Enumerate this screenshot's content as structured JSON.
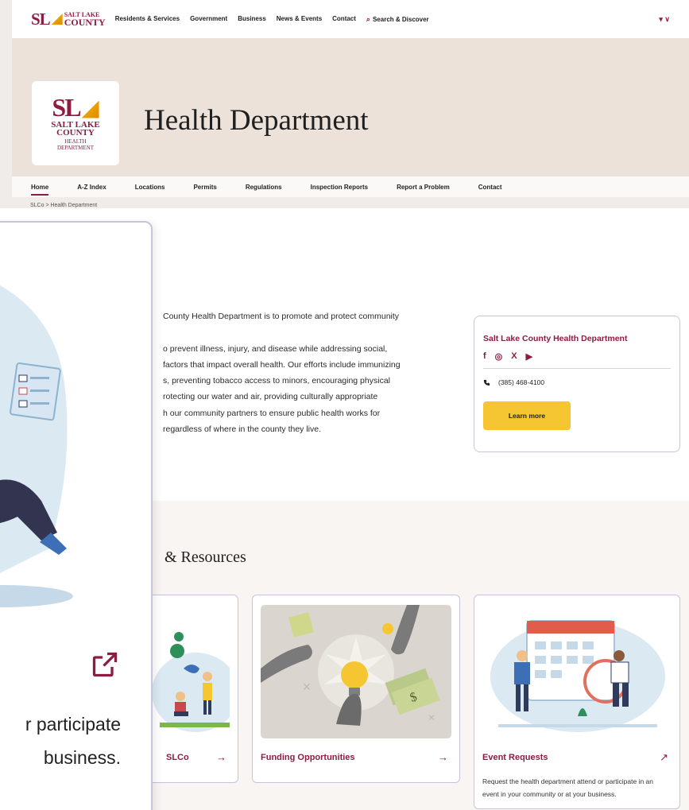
{
  "topnav": {
    "logo": {
      "mark": "SL",
      "line1": "SALT LAKE",
      "line2": "COUNTY"
    },
    "items": [
      "Residents & Services",
      "Government",
      "Business",
      "News & Events",
      "Contact"
    ],
    "search": "Search & Discover",
    "lang": "▾ ∨"
  },
  "hero": {
    "logo": {
      "mark": "SL",
      "line1": "SALT LAKE",
      "line2": "COUNTY",
      "line3": "HEALTH",
      "line4": "DEPARTMENT"
    },
    "title": "Health Department"
  },
  "subnav": [
    "Home",
    "A-Z Index",
    "Locations",
    "Permits",
    "Regulations",
    "Inspection Reports",
    "Report a Problem",
    "Contact"
  ],
  "breadcrumb": "SLCo  >  Health Department",
  "mission": [
    "County Health Department is to promote and protect community",
    "",
    "o prevent illness, injury, and disease while addressing social,",
    " factors that impact overall health. Our efforts include immunizing",
    "s, preventing tobacco access to minors, encouraging physical",
    "rotecting our water and air, providing culturally appropriate",
    "h our community partners to ensure public health works for",
    " regardless of where in the county they live."
  ],
  "contact": {
    "name": "Salt Lake County Health Department",
    "phone": "(385) 468-4100",
    "learn_more": "Learn more",
    "social": [
      "f",
      "◎",
      "X",
      "▶"
    ]
  },
  "section_title": "& Resources",
  "cards": [
    {
      "title": "SLCo",
      "arrow": "→"
    },
    {
      "title": "Funding Opportunities",
      "arrow": "→"
    },
    {
      "title": "Event Requests",
      "arrow": "↗",
      "desc": "Request the health department attend or participate in an event in your community or at your business."
    }
  ],
  "zoom": {
    "text_line1": "r participate",
    "text_line2": "business."
  },
  "colors": {
    "brand": "#8c1d40",
    "accent": "#f5c532",
    "hero_bg": "#ece2d9"
  }
}
